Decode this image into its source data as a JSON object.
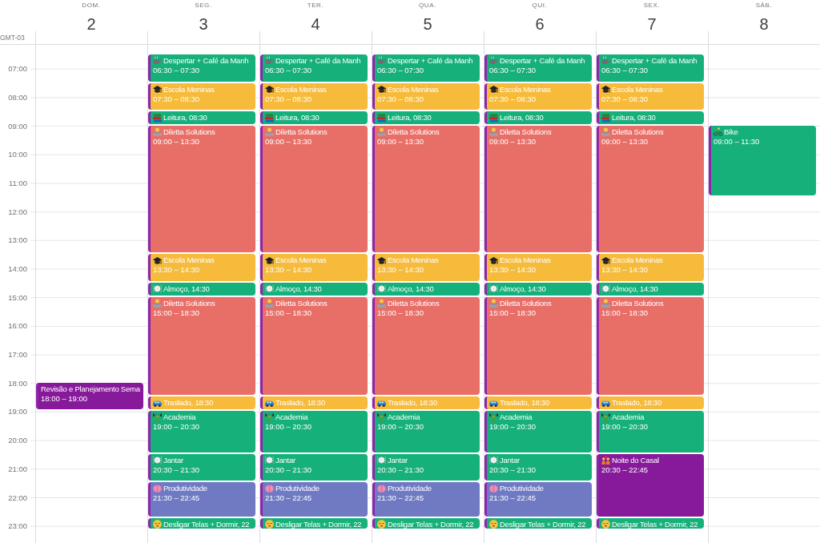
{
  "timezone": "GMT-03",
  "hours": [
    "07:00",
    "08:00",
    "09:00",
    "10:00",
    "11:00",
    "12:00",
    "13:00",
    "14:00",
    "15:00",
    "16:00",
    "17:00",
    "18:00",
    "19:00",
    "20:00",
    "21:00",
    "22:00",
    "23:00"
  ],
  "days": [
    {
      "name": "DOM.",
      "number": "2",
      "events": [
        {
          "kind": "plain",
          "title": "Revisão e Planejamento Sema",
          "time": "18:00 – 19:00",
          "color": "#871a9a"
        }
      ]
    },
    {
      "name": "SEG.",
      "number": "3",
      "events": [
        {
          "kind": "wake",
          "title": "Despertar + Café da Manh",
          "time": "06:30 – 07:30",
          "color": "#16b07a"
        },
        {
          "kind": "school",
          "title": "Escola Meninas",
          "time": "07:30 – 08:30",
          "color": "#f6bb3a"
        },
        {
          "kind": "reading",
          "title": "Leitura, 08:30",
          "color": "#16b07a"
        },
        {
          "kind": "work",
          "title": "Diletta Solutions",
          "time": "09:00 – 13:30",
          "color": "#e86f68"
        },
        {
          "kind": "school",
          "title": "Escola Meninas",
          "time": "13:30 – 14:30",
          "color": "#f6bb3a"
        },
        {
          "kind": "meal",
          "title": "Almoço, 14:30",
          "color": "#16b07a"
        },
        {
          "kind": "work",
          "title": "Diletta Solutions",
          "time": "15:00 – 18:30",
          "color": "#e86f68"
        },
        {
          "kind": "commute",
          "title": "Traslado, 18:30",
          "color": "#f6bb3a"
        },
        {
          "kind": "gym",
          "title": "Academia",
          "time": "19:00 – 20:30",
          "color": "#16b07a"
        },
        {
          "kind": "meal",
          "title": "Jantar",
          "time": "20:30 – 21:30",
          "color": "#16b07a"
        },
        {
          "kind": "focus",
          "title": "Produtividade",
          "time": "21:30 – 22:45",
          "color": "#6f7ac3"
        },
        {
          "kind": "sleep",
          "title": "Desligar Telas + Dormir, 22",
          "color": "#16b07a"
        }
      ]
    },
    {
      "name": "TER.",
      "number": "4",
      "events": [
        {
          "kind": "wake",
          "title": "Despertar + Café da Manh",
          "time": "06:30 – 07:30",
          "color": "#16b07a"
        },
        {
          "kind": "school",
          "title": "Escola Meninas",
          "time": "07:30 – 08:30",
          "color": "#f6bb3a"
        },
        {
          "kind": "reading",
          "title": "Leitura, 08:30",
          "color": "#16b07a"
        },
        {
          "kind": "work",
          "title": "Diletta Solutions",
          "time": "09:00 – 13:30",
          "color": "#e86f68"
        },
        {
          "kind": "school",
          "title": "Escola Meninas",
          "time": "13:30 – 14:30",
          "color": "#f6bb3a"
        },
        {
          "kind": "meal",
          "title": "Almoço, 14:30",
          "color": "#16b07a"
        },
        {
          "kind": "work",
          "title": "Diletta Solutions",
          "time": "15:00 – 18:30",
          "color": "#e86f68"
        },
        {
          "kind": "commute",
          "title": "Traslado, 18:30",
          "color": "#f6bb3a"
        },
        {
          "kind": "gym",
          "title": "Academia",
          "time": "19:00 – 20:30",
          "color": "#16b07a"
        },
        {
          "kind": "meal",
          "title": "Jantar",
          "time": "20:30 – 21:30",
          "color": "#16b07a"
        },
        {
          "kind": "focus",
          "title": "Produtividade",
          "time": "21:30 – 22:45",
          "color": "#6f7ac3"
        },
        {
          "kind": "sleep",
          "title": "Desligar Telas + Dormir, 22",
          "color": "#16b07a"
        }
      ]
    },
    {
      "name": "QUA.",
      "number": "5",
      "events": [
        {
          "kind": "wake",
          "title": "Despertar + Café da Manh",
          "time": "06:30 – 07:30",
          "color": "#16b07a"
        },
        {
          "kind": "school",
          "title": "Escola Meninas",
          "time": "07:30 – 08:30",
          "color": "#f6bb3a"
        },
        {
          "kind": "reading",
          "title": "Leitura, 08:30",
          "color": "#16b07a"
        },
        {
          "kind": "work",
          "title": "Diletta Solutions",
          "time": "09:00 – 13:30",
          "color": "#e86f68"
        },
        {
          "kind": "school",
          "title": "Escola Meninas",
          "time": "13:30 – 14:30",
          "color": "#f6bb3a"
        },
        {
          "kind": "meal",
          "title": "Almoço, 14:30",
          "color": "#16b07a"
        },
        {
          "kind": "work",
          "title": "Diletta Solutions",
          "time": "15:00 – 18:30",
          "color": "#e86f68"
        },
        {
          "kind": "commute",
          "title": "Traslado, 18:30",
          "color": "#f6bb3a"
        },
        {
          "kind": "gym",
          "title": "Academia",
          "time": "19:00 – 20:30",
          "color": "#16b07a"
        },
        {
          "kind": "meal",
          "title": "Jantar",
          "time": "20:30 – 21:30",
          "color": "#16b07a"
        },
        {
          "kind": "focus",
          "title": "Produtividade",
          "time": "21:30 – 22:45",
          "color": "#6f7ac3"
        },
        {
          "kind": "sleep",
          "title": "Desligar Telas + Dormir, 22",
          "color": "#16b07a"
        }
      ]
    },
    {
      "name": "QUI.",
      "number": "6",
      "events": [
        {
          "kind": "wake",
          "title": "Despertar + Café da Manh",
          "time": "06:30 – 07:30",
          "color": "#16b07a"
        },
        {
          "kind": "school",
          "title": "Escola Meninas",
          "time": "07:30 – 08:30",
          "color": "#f6bb3a"
        },
        {
          "kind": "reading",
          "title": "Leitura, 08:30",
          "color": "#16b07a"
        },
        {
          "kind": "work",
          "title": "Diletta Solutions",
          "time": "09:00 – 13:30",
          "color": "#e86f68"
        },
        {
          "kind": "school",
          "title": "Escola Meninas",
          "time": "13:30 – 14:30",
          "color": "#f6bb3a"
        },
        {
          "kind": "meal",
          "title": "Almoço, 14:30",
          "color": "#16b07a"
        },
        {
          "kind": "work",
          "title": "Diletta Solutions",
          "time": "15:00 – 18:30",
          "color": "#e86f68"
        },
        {
          "kind": "commute",
          "title": "Traslado, 18:30",
          "color": "#f6bb3a"
        },
        {
          "kind": "gym",
          "title": "Academia",
          "time": "19:00 – 20:30",
          "color": "#16b07a"
        },
        {
          "kind": "meal",
          "title": "Jantar",
          "time": "20:30 – 21:30",
          "color": "#16b07a"
        },
        {
          "kind": "focus",
          "title": "Produtividade",
          "time": "21:30 – 22:45",
          "color": "#6f7ac3"
        },
        {
          "kind": "sleep",
          "title": "Desligar Telas + Dormir, 22",
          "color": "#16b07a"
        }
      ]
    },
    {
      "name": "SEX.",
      "number": "7",
      "events": [
        {
          "kind": "wake",
          "title": "Despertar + Café da Manh",
          "time": "06:30 – 07:30",
          "color": "#16b07a"
        },
        {
          "kind": "school",
          "title": "Escola Meninas",
          "time": "07:30 – 08:30",
          "color": "#f6bb3a"
        },
        {
          "kind": "reading",
          "title": "Leitura, 08:30",
          "color": "#16b07a"
        },
        {
          "kind": "work",
          "title": "Diletta Solutions",
          "time": "09:00 – 13:30",
          "color": "#e86f68"
        },
        {
          "kind": "school",
          "title": "Escola Meninas",
          "time": "13:30 – 14:30",
          "color": "#f6bb3a"
        },
        {
          "kind": "meal",
          "title": "Almoço, 14:30",
          "color": "#16b07a"
        },
        {
          "kind": "work",
          "title": "Diletta Solutions",
          "time": "15:00 – 18:30",
          "color": "#e86f68"
        },
        {
          "kind": "commute",
          "title": "Traslado, 18:30",
          "color": "#f6bb3a"
        },
        {
          "kind": "gym",
          "title": "Academia",
          "time": "19:00 – 20:30",
          "color": "#16b07a"
        },
        {
          "kind": "date",
          "title": "Noite do Casal",
          "time": "20:30 – 22:45",
          "color": "#871a9a"
        },
        {
          "kind": "sleep",
          "title": "Desligar Telas + Dormir, 22",
          "color": "#16b07a"
        }
      ]
    },
    {
      "name": "SÁB.",
      "number": "8",
      "events": [
        {
          "kind": "bike",
          "title": "Bike",
          "time": "09:00 – 11:30",
          "color": "#16b07a"
        }
      ]
    }
  ]
}
